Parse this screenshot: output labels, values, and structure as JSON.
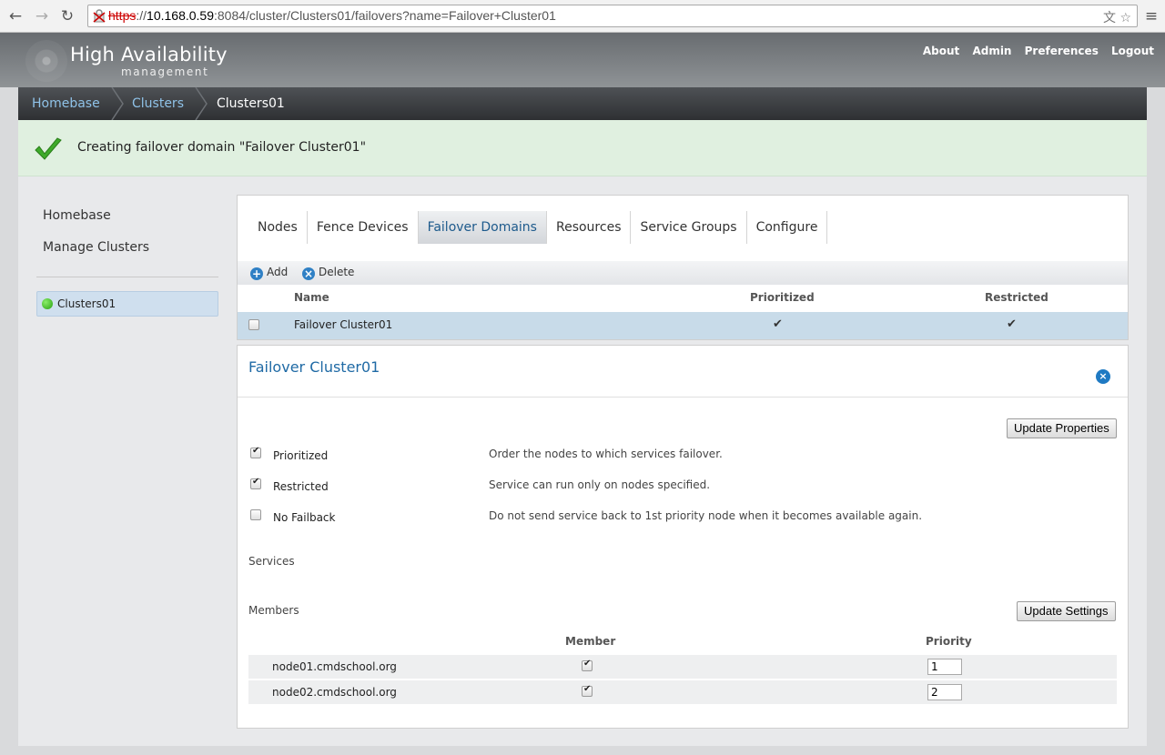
{
  "browser": {
    "url_scheme": "https",
    "url_host": "10.168.0.59",
    "url_rest": ":8084/cluster/Clusters01/failovers?name=Failover+Cluster01"
  },
  "header": {
    "brand_title": "High Availability",
    "brand_subtitle": "management",
    "links": [
      "About",
      "Admin",
      "Preferences",
      "Logout"
    ]
  },
  "breadcrumb": {
    "items": [
      "Homebase",
      "Clusters",
      "Clusters01"
    ]
  },
  "notice": {
    "text": "Creating failover domain \"Failover Cluster01\""
  },
  "sidebar": {
    "links": [
      "Homebase",
      "Manage Clusters"
    ],
    "cluster": {
      "name": "Clusters01",
      "status_color": "#2fb113"
    }
  },
  "tabs": [
    "Nodes",
    "Fence Devices",
    "Failover Domains",
    "Resources",
    "Service Groups",
    "Configure"
  ],
  "active_tab": "Failover Domains",
  "toolbar": {
    "add_label": "Add",
    "delete_label": "Delete"
  },
  "domain_table": {
    "headers": [
      "Name",
      "Prioritized",
      "Restricted"
    ],
    "rows": [
      {
        "name": "Failover Cluster01",
        "prioritized": true,
        "restricted": true,
        "selected": true
      }
    ]
  },
  "detail": {
    "title": "Failover Cluster01",
    "update_properties_label": "Update Properties",
    "properties": [
      {
        "label": "Prioritized",
        "checked": true,
        "description": "Order the nodes to which services failover."
      },
      {
        "label": "Restricted",
        "checked": true,
        "description": "Service can run only on nodes specified."
      },
      {
        "label": "No Failback",
        "checked": false,
        "description": "Do not send service back to 1st priority node when it becomes available again."
      }
    ],
    "services_label": "Services",
    "members_label": "Members",
    "update_settings_label": "Update Settings",
    "member_headers": [
      "Member",
      "Priority"
    ],
    "members": [
      {
        "node": "node01.cmdschool.org",
        "member": true,
        "priority": "1"
      },
      {
        "node": "node02.cmdschool.org",
        "member": true,
        "priority": "2"
      }
    ]
  }
}
